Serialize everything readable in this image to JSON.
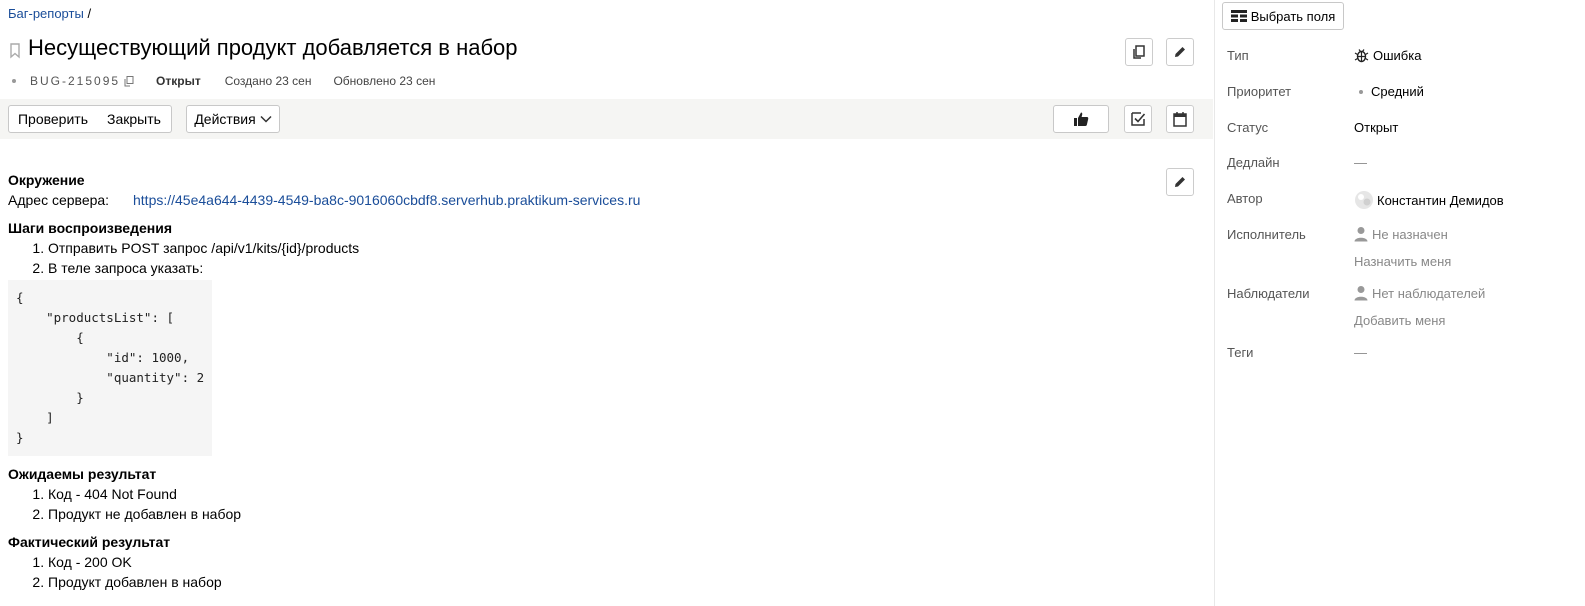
{
  "breadcrumb": {
    "link": "Баг-репорты",
    "separator": "/"
  },
  "issue": {
    "title": "Несуществующий продукт добавляется в набор",
    "key": "BUG-215095",
    "status": "Открыт",
    "created": "Создано 23 сен",
    "updated": "Обновлено 23 сен"
  },
  "toolbar": {
    "check_label": "Проверить",
    "close_label": "Закрыть",
    "actions_label": "Действия"
  },
  "description": {
    "env_title": "Окружение",
    "server_label": "Адрес сервера:",
    "server_url": "https://45e4a644-4439-4549-ba8c-9016060cbdf8.serverhub.praktikum-services.ru",
    "steps_title": "Шаги воспроизведения",
    "steps": [
      "Отправить POST запрос /api/v1/kits/{id}/products",
      "В теле запроса указать:"
    ],
    "code": "{\n    \"productsList\": [\n        {\n            \"id\": 1000,\n            \"quantity\": 2\n        }\n    ]\n}",
    "expected_title": "Ожидаемы результат",
    "expected": [
      "Код - 404 Not Found",
      "Продукт не добавлен в набор"
    ],
    "actual_title": "Фактический результат",
    "actual": [
      "Код - 200 OK",
      "Продукт добавлен в набор"
    ]
  },
  "sidebar": {
    "choose_fields": "Выбрать поля",
    "type_label": "Тип",
    "type_value": "Ошибка",
    "priority_label": "Приоритет",
    "priority_value": "Средний",
    "status_label": "Статус",
    "status_value": "Открыт",
    "deadline_label": "Дедлайн",
    "deadline_value": "—",
    "author_label": "Автор",
    "author_value": "Константин Демидов",
    "assignee_label": "Исполнитель",
    "assignee_value": "Не назначен",
    "assign_me": "Назначить меня",
    "followers_label": "Наблюдатели",
    "followers_value": "Нет наблюдателей",
    "add_me": "Добавить меня",
    "tags_label": "Теги",
    "tags_value": "—"
  },
  "colors": {
    "link": "#1a4d99",
    "toolbar_bg": "#f5f5f3",
    "code_bg": "#f5f5f5"
  }
}
